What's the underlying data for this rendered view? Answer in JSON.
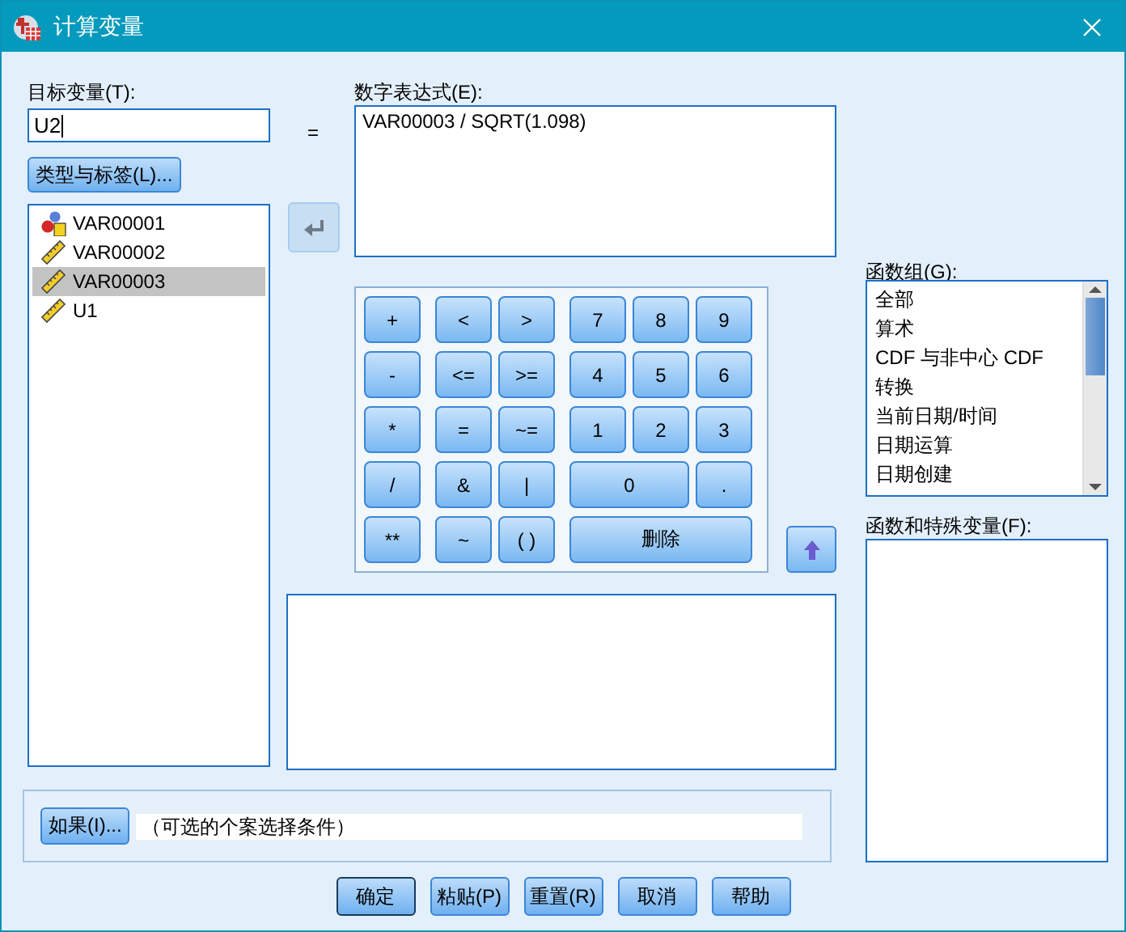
{
  "window": {
    "title": "计算变量"
  },
  "target_variable": {
    "label": "目标变量(T):",
    "value": "U2"
  },
  "type_label_button": "类型与标签(L)...",
  "equals": "=",
  "variables": [
    {
      "name": "VAR00001",
      "kind": "nominal",
      "selected": false
    },
    {
      "name": "VAR00002",
      "kind": "scale",
      "selected": false
    },
    {
      "name": "VAR00003",
      "kind": "scale",
      "selected": true
    },
    {
      "name": "U1",
      "kind": "scale",
      "selected": false
    }
  ],
  "expression": {
    "label": "数字表达式(E):",
    "value": "VAR00003 / SQRT(1.098)"
  },
  "keypad": [
    [
      "+",
      "<",
      ">",
      "7",
      "8",
      "9"
    ],
    [
      "-",
      "<=",
      ">=",
      "4",
      "5",
      "6"
    ],
    [
      "*",
      "=",
      "~=",
      "1",
      "2",
      "3"
    ],
    [
      "/",
      "&",
      "|",
      "0",
      "."
    ],
    [
      "**",
      "~",
      "( )",
      "删除"
    ]
  ],
  "function_groups": {
    "label": "函数组(G):",
    "items": [
      {
        "text": "全部",
        "selected": false
      },
      {
        "text": "算术",
        "selected": false
      },
      {
        "text": "CDF 与非中心 CDF",
        "selected": false
      },
      {
        "text": "转换",
        "selected": false
      },
      {
        "text": "当前日期/时间",
        "selected": false
      },
      {
        "text": "日期运算",
        "selected": false
      },
      {
        "text": "日期创建",
        "selected": false
      }
    ]
  },
  "functions": {
    "label": "函数和特殊变量(F):"
  },
  "if_condition": {
    "button": "如果(I)...",
    "text": "（可选的个案选择条件）"
  },
  "buttons": [
    {
      "label": "确定",
      "default": true
    },
    {
      "label": "粘贴(P)",
      "default": false
    },
    {
      "label": "重置(R)",
      "default": false
    },
    {
      "label": "取消",
      "default": false
    },
    {
      "label": "帮助",
      "default": false
    }
  ]
}
